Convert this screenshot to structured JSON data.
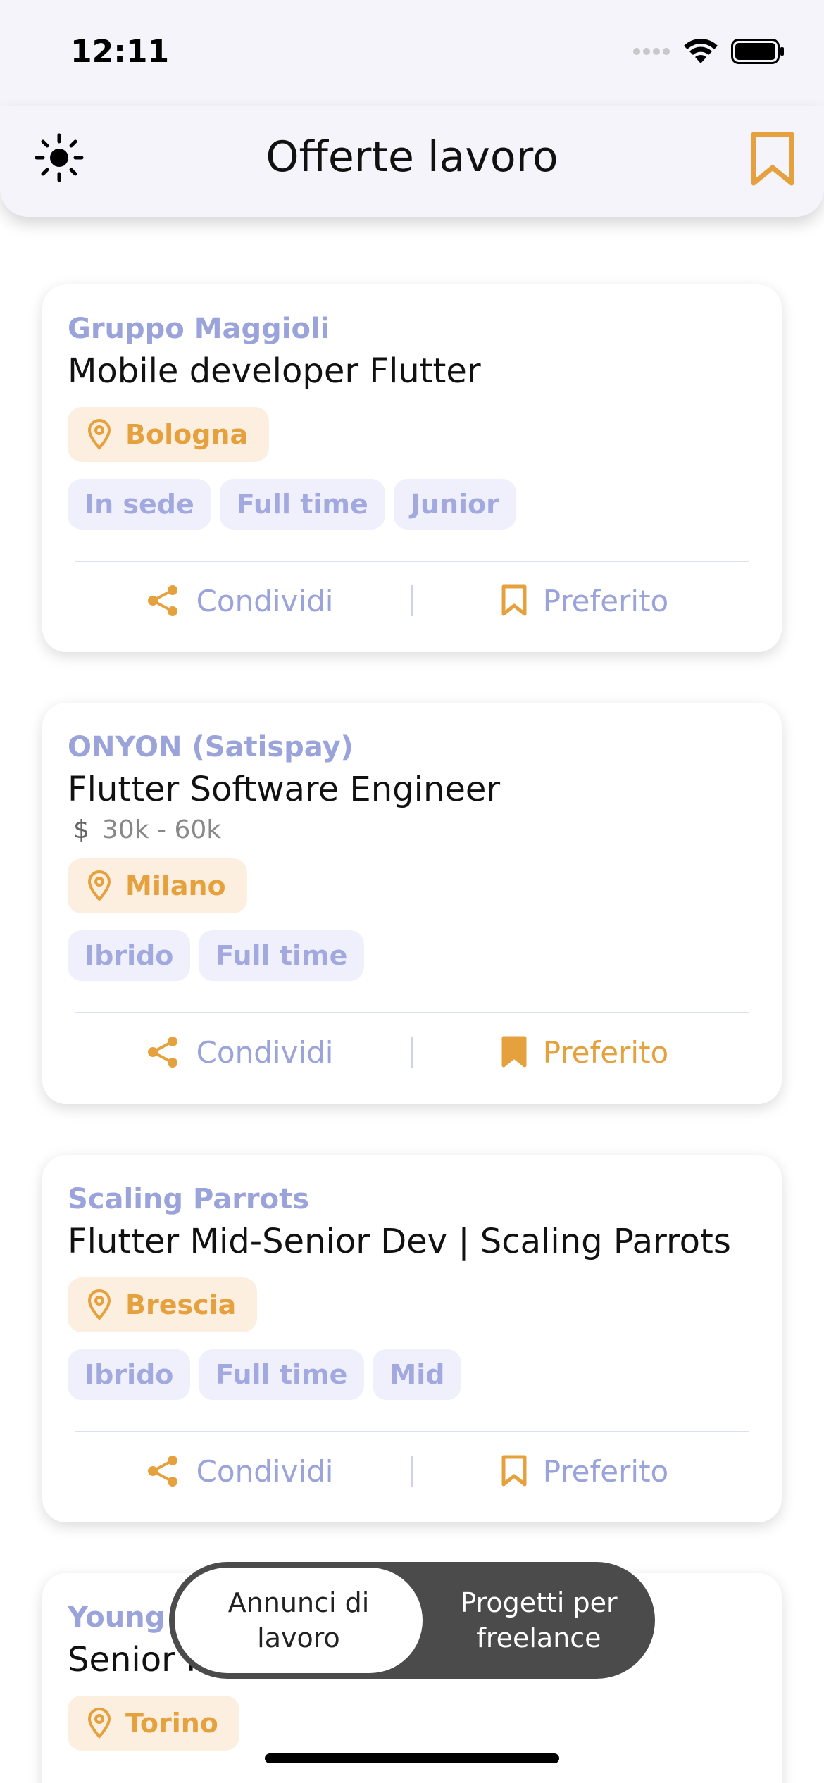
{
  "status": {
    "time": "12:11"
  },
  "header": {
    "title": "Offerte lavoro"
  },
  "cards": [
    {
      "company": "Gruppo Maggioli",
      "title": "Mobile developer Flutter",
      "location": "Bologna",
      "tags": [
        "In sede",
        "Full time",
        "Junior"
      ],
      "share_label": "Condividi",
      "favorite_label": "Preferito",
      "favorited": false
    },
    {
      "company": "ONYON (Satispay)",
      "title": "Flutter Software Engineer",
      "salary": "30k - 60k",
      "currency": "$",
      "location": "Milano",
      "tags": [
        "Ibrido",
        "Full time"
      ],
      "share_label": "Condividi",
      "favorite_label": "Preferito",
      "favorited": true
    },
    {
      "company": "Scaling Parrots",
      "title": "Flutter Mid-Senior Dev | Scaling Parrots",
      "location": "Brescia",
      "tags": [
        "Ibrido",
        "Full time",
        "Mid"
      ],
      "share_label": "Condividi",
      "favorite_label": "Preferito",
      "favorited": false
    },
    {
      "company": "Young",
      "title": "Senior Flutter Developer",
      "location": "Torino"
    }
  ],
  "toggle": {
    "selected_line1": "Annunci di",
    "selected_line2": "lavoro",
    "other_line1": "Progetti per",
    "other_line2": "freelance"
  },
  "colors": {
    "accent": "#e6a13f",
    "company": "#9aa3da",
    "tag_bg": "#eff0fb",
    "location_bg": "#fdefe0"
  }
}
